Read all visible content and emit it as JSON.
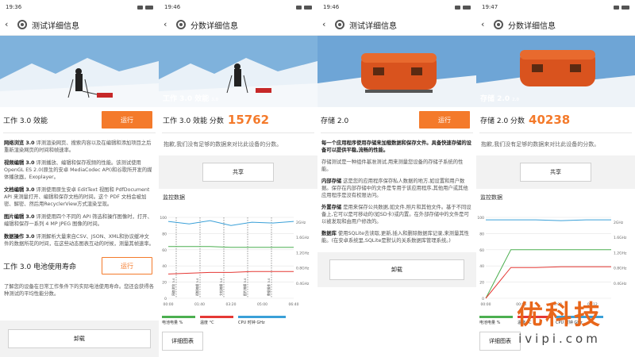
{
  "panels": [
    {
      "time": "19:36",
      "title": "测试详细信息",
      "bench1": {
        "name": "工作 3.0 效能",
        "run_label": "运行"
      },
      "desc": [
        {
          "head": "网络浏览 3.0",
          "text": " 评测渲染网页、搜索内容以及在编辑和添加项目之后重新渲染网页的时间和帧速率。"
        },
        {
          "head": "视频编辑 3.0",
          "text": " 评测播放、编辑和保存视频的性能。该测试使用 OpenGL ES 2.0(原生的安卓 MediaCodec API)和谷歌所开发的媒体播放器，Exoplayer。"
        },
        {
          "head": "文档编辑 3.0",
          "text": " 评测使用原生安卓 EditText 视图和 PdfDocument API 来测量打开、编辑和保存文档的时间。这个 PDF 文档会被加密、解密、然后用RecyclerView方式渲染呈现。"
        },
        {
          "head": "图片编辑 3.0",
          "text": " 评测使用四个不同的 API 筛选和操作图像时，打开、编辑和保存一系列 4 MP JPEG 图像的时间。"
        },
        {
          "head": "数据操作 3.0",
          "text": " 评测解析大量来自CSV、JSON、XML和协议缓冲文件的数据所花的时间，在这些动态图表互动的时候，测量其帧速率。"
        }
      ],
      "bench2": {
        "name": "工作 3.0 电池使用寿命",
        "run_label": "运行"
      },
      "bench2_desc": "了解您的设备在日常工作条件下的实际电池使用寿命。您还会获得各种测试的平均性能分数。",
      "uninstall_label": "卸载"
    },
    {
      "time": "19:46",
      "title": "分数详细信息",
      "hero_caption": "工作 3.0 效能",
      "hero_ver": "3.0",
      "score_label": "工作 3.0 效能 分数",
      "score_value": "15762",
      "sorry": "抱歉,我们没有足够的数据来对比此设备的分数。",
      "share_label": "共享",
      "monitor_label": "监控数据",
      "chart_left_ticks": [
        "100",
        "80",
        "60",
        "40",
        "20",
        "0"
      ],
      "chart_right_ticks": [
        "2GHz",
        "1.6GHz",
        "1.2GHz",
        "0.8GHz",
        "0.4GHz"
      ],
      "chart_x_ticks": [
        "00:00",
        "01:40",
        "03:20",
        "05:00",
        "06:40"
      ],
      "event_labels": [
        "网络浏览 3.0",
        "视频编辑 3.0",
        "文档编辑 3.0",
        "图片编辑 3.0",
        "数据操作 3.0"
      ],
      "legend": [
        "电池电量 %",
        "温度 °C",
        "CPU 时钟 GHz"
      ],
      "details_label": "详细图表",
      "scores_label": "分数"
    },
    {
      "time": "19:46",
      "title": "测试详细信息",
      "bench_name": "存储 2.0",
      "run_label": "运行",
      "intro_bold": "每一个应用程序使用存储来加载数据和保存文件。具备快速存储的设备可以提供平稳,流畅的性能。",
      "intro2": "存储测试是一种组件基准测试,用来测量您设备的存储子系统的性能。",
      "items": [
        {
          "head": "内部存储",
          "text": " 这是您的应用程序保存私人数据的地方,如设置和用户数据。保存在内部存储中的文件是专用于该应用程序,其他用户或其他应用程序是没有权限访问。"
        },
        {
          "head": "外置存储",
          "text": " 是用来保存公共数据,如文件,照片和其他文件。基于不同设备上,它可以是可移动的(如SD卡)或内置。在外部存储中的文件是可以被发现和由用户修改的。"
        },
        {
          "head": "数据库",
          "text": " 使用SQLite去读取,更新,插入和删除数据库记录,来测量其性能。(在安卓系统里,SQLite是默认的关系数据库管理系统。)"
        }
      ],
      "uninstall_label": "卸载"
    },
    {
      "time": "19:47",
      "title": "分数详细信息",
      "hero_caption": "存储 2.0",
      "hero_ver": "2.0",
      "score_label": "存储 2.0 分数",
      "score_value": "40238",
      "sorry": "抱歉,我们没有足够的数据来对比此设备的分数。",
      "share_label": "共享",
      "monitor_label": "监控数据",
      "chart_left_ticks": [
        "100",
        "80",
        "60",
        "40",
        "20",
        "0"
      ],
      "chart_right_ticks": [
        "2GHz",
        "1.6GHz",
        "1.2GHz",
        "0.8GHz",
        "0.4GHz"
      ],
      "chart_x_ticks": [
        "00:00",
        "00:04",
        "00:08",
        "00:12"
      ],
      "legend": [
        "电池电量 %",
        "温度 °C",
        "CPU 时钟 GHz"
      ],
      "details_label": "详细图表",
      "scores_label": "分数"
    }
  ],
  "watermark": {
    "main": "优科技",
    "sub": "ivipi.com"
  },
  "colors": {
    "accent": "#f47a2b",
    "battery": "#4caf50",
    "temperature": "#e53935",
    "cpu": "#3aa0d8"
  },
  "chart_data": [
    {
      "type": "line",
      "x_ticks": [
        "00:00",
        "01:40",
        "03:20",
        "05:00",
        "06:40"
      ],
      "ylim": [
        0,
        100
      ],
      "y2_ticks": [
        "0.4GHz",
        "0.8GHz",
        "1.2GHz",
        "1.6GHz",
        "2GHz"
      ],
      "series": [
        {
          "name": "电池电量 %",
          "values": [
            64,
            64,
            64,
            63,
            63,
            63,
            63
          ]
        },
        {
          "name": "温度 °C",
          "values": [
            30,
            31,
            32,
            32,
            33,
            33,
            33
          ]
        },
        {
          "name": "CPU 时钟 GHz",
          "values": [
            95,
            92,
            96,
            90,
            94,
            93,
            95
          ]
        }
      ],
      "events": [
        "网络浏览 3.0",
        "视频编辑 3.0",
        "文档编辑 3.0",
        "图片编辑 3.0",
        "数据操作 3.0"
      ]
    },
    {
      "type": "line",
      "x_ticks": [
        "00:00",
        "00:04",
        "00:08",
        "00:12"
      ],
      "ylim": [
        0,
        100
      ],
      "y2_ticks": [
        "0.4GHz",
        "0.8GHz",
        "1.2GHz",
        "1.6GHz",
        "2GHz"
      ],
      "series": [
        {
          "name": "电池电量 %",
          "values": [
            0,
            60,
            60,
            60,
            60,
            60
          ]
        },
        {
          "name": "温度 °C",
          "values": [
            0,
            38,
            38,
            39,
            39,
            39
          ]
        },
        {
          "name": "CPU 时钟 GHz",
          "values": [
            97,
            97,
            97,
            96,
            97,
            97
          ]
        }
      ]
    }
  ]
}
